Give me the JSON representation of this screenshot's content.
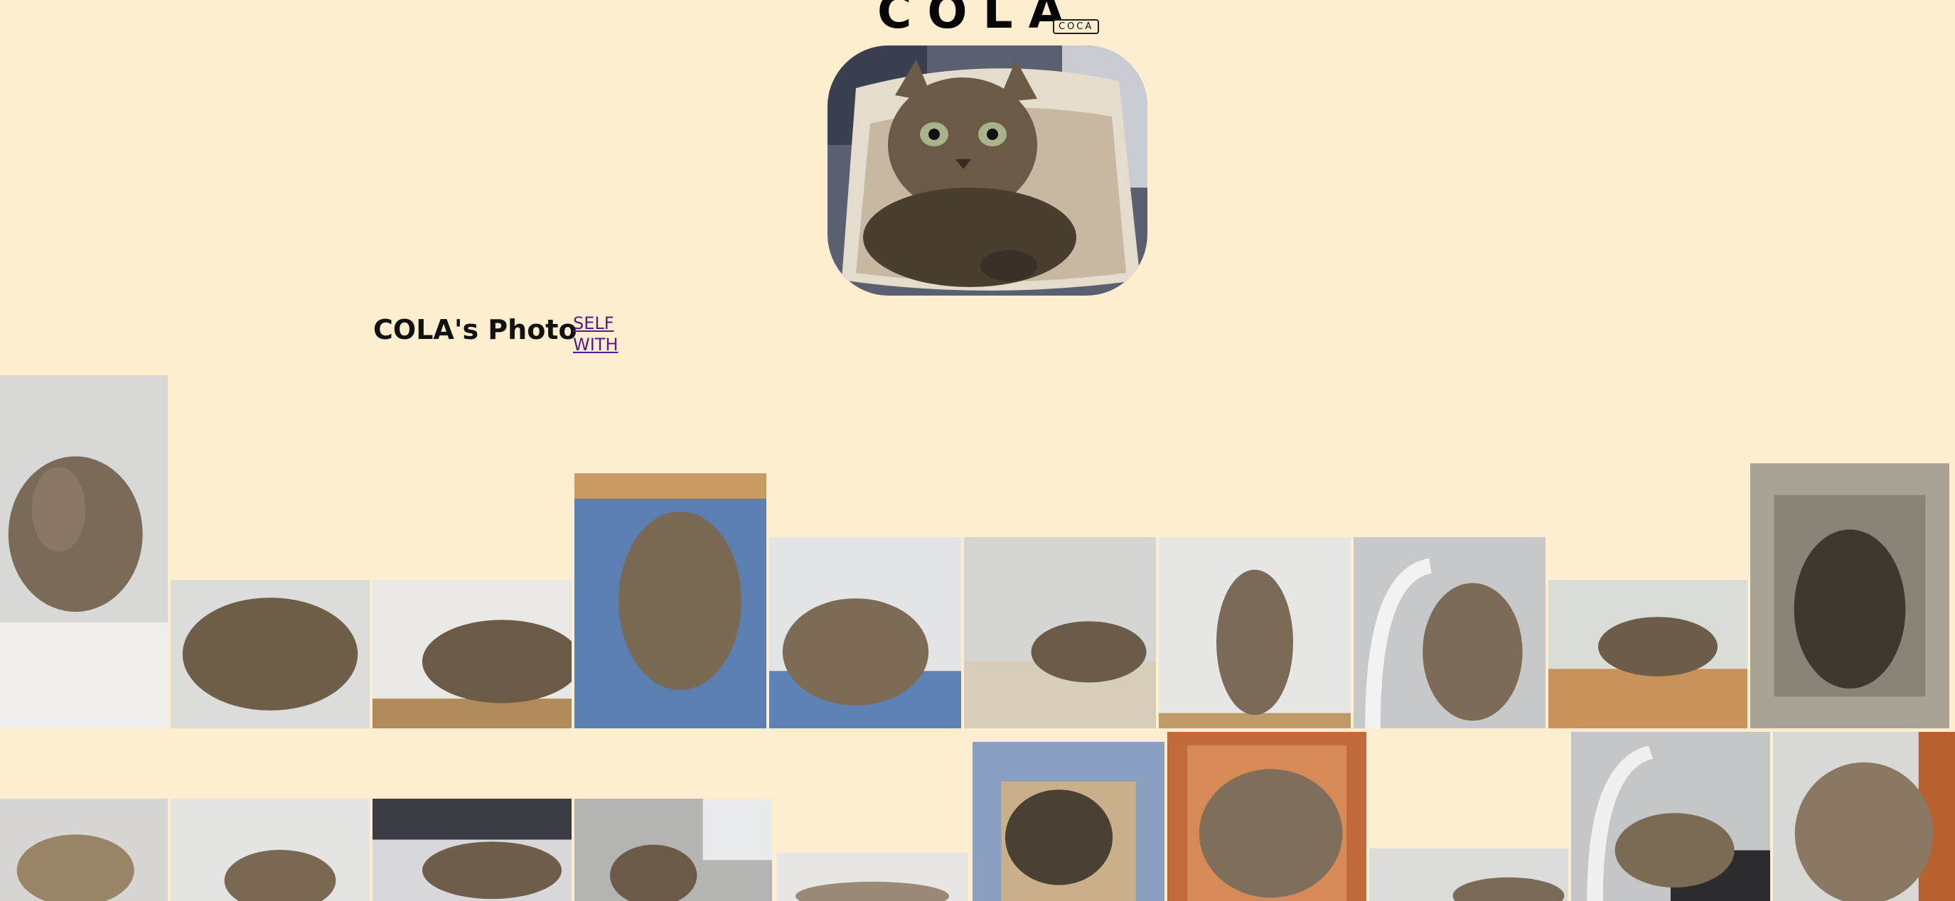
{
  "header": {
    "title": "COLA",
    "tag": "COCA"
  },
  "gallery": {
    "title": "COLA's Photo",
    "nav": [
      "SELF",
      "WITH"
    ]
  },
  "palette": {
    "background": "#fdeed0",
    "link": "#551a8b"
  }
}
